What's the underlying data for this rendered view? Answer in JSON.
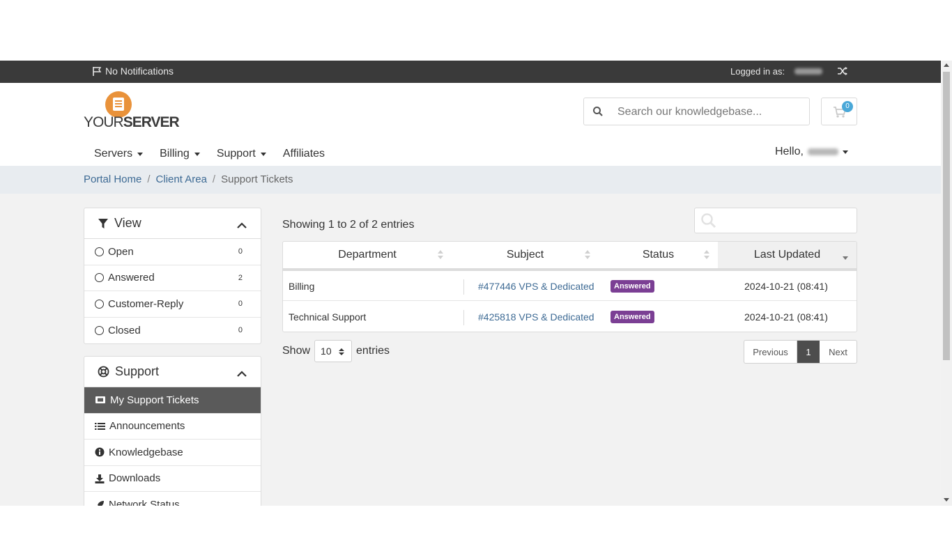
{
  "topbar": {
    "notifications": "No Notifications",
    "logged_in_label": "Logged in as:"
  },
  "header": {
    "logo_word_light": "YOUR",
    "logo_word_bold": "SERVER",
    "search_placeholder": "Search our knowledgebase...",
    "cart_count": "0"
  },
  "nav": {
    "items": [
      {
        "label": "Servers",
        "has_caret": true
      },
      {
        "label": "Billing",
        "has_caret": true
      },
      {
        "label": "Support",
        "has_caret": true
      },
      {
        "label": "Affiliates",
        "has_caret": false
      }
    ],
    "hello": "Hello,"
  },
  "breadcrumb": {
    "home": "Portal Home",
    "sep": "/",
    "client_area": "Client Area",
    "current": "Support Tickets"
  },
  "view_panel": {
    "title": "View",
    "items": [
      {
        "label": "Open",
        "count": "0"
      },
      {
        "label": "Answered",
        "count": "2"
      },
      {
        "label": "Customer-Reply",
        "count": "0"
      },
      {
        "label": "Closed",
        "count": "0"
      }
    ]
  },
  "support_panel": {
    "title": "Support",
    "items": [
      {
        "label": "My Support Tickets",
        "icon": "ticket-icon",
        "active": true
      },
      {
        "label": "Announcements",
        "icon": "list-icon"
      },
      {
        "label": "Knowledgebase",
        "icon": "info-icon"
      },
      {
        "label": "Downloads",
        "icon": "download-icon"
      },
      {
        "label": "Network Status",
        "icon": "rocket-icon"
      }
    ]
  },
  "tickets": {
    "showing": "Showing 1 to 2 of 2 entries",
    "columns": [
      "Department",
      "Subject",
      "Status",
      "Last Updated"
    ],
    "rows": [
      {
        "department": "Billing",
        "subject": "#477446 VPS & Dedicated",
        "status": "Answered",
        "updated": "2024-10-21 (08:41)"
      },
      {
        "department": "Technical Support",
        "subject": "#425818 VPS & Dedicated",
        "status": "Answered",
        "updated": "2024-10-21 (08:41)"
      }
    ],
    "show_label": "Show",
    "page_size": "10",
    "entries_label": "entries",
    "prev": "Previous",
    "page": "1",
    "next": "Next"
  },
  "colors": {
    "topbar": "#3a3a3a",
    "link": "#3d6a94",
    "badge": "#7b3f94",
    "logo_orange": "#e9923a",
    "cart_badge": "#4aa8d8",
    "active_item": "#5a5a5a"
  }
}
